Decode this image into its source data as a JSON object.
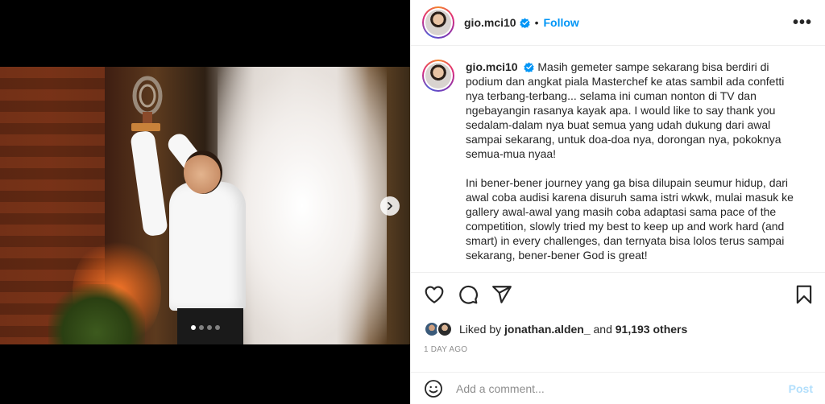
{
  "post": {
    "username": "gio.mci10",
    "separator": "•",
    "follow_label": "Follow",
    "more_label": "•••",
    "carousel": {
      "total_slides": 4,
      "active_slide": 1
    },
    "caption": {
      "username": "gio.mci10",
      "paragraph1": "Masih gemeter sampe sekarang bisa berdiri di podium dan angkat piala Masterchef ke atas sambil ada confetti nya terbang-terbang... selama ini cuman nonton di TV dan ngebayangin rasanya kayak apa. I would like to say thank you sedalam-dalam nya buat semua yang udah dukung dari awal sampai sekarang, untuk doa-doa nya, dorongan nya, pokoknya semua-mua nyaa!",
      "paragraph2": "Ini bener-bener journey yang ga bisa dilupain seumur hidup, dari awal coba audisi karena disuruh sama istri wkwk, mulai masuk ke gallery awal-awal yang masih coba adaptasi sama pace of the competition, slowly tried my best to keep up and work hard (and smart) in every challenges, dan ternyata bisa lolos terus sampai sekarang, bener-bener God is great!"
    },
    "likes": {
      "prefix": "Liked by",
      "user": "jonathan.alden_",
      "and": "and",
      "others": "91,193 others"
    },
    "timestamp": "1 DAY AGO",
    "comment": {
      "placeholder": "Add a comment...",
      "post_label": "Post"
    }
  },
  "icons": [
    "verified-icon",
    "more-icon",
    "chevron-right-icon",
    "heart-icon",
    "comment-icon",
    "share-icon",
    "bookmark-icon",
    "emoji-icon"
  ],
  "colors": {
    "accent": "#0095f6",
    "post_disabled": "#b2dffc",
    "muted": "#8e8e8e",
    "text": "#262626"
  }
}
